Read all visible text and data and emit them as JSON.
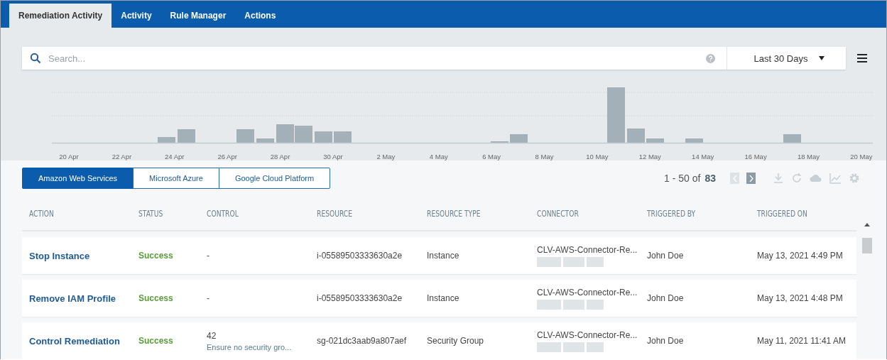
{
  "tabs": [
    {
      "label": "Remediation Activity",
      "selected": true
    },
    {
      "label": "Activity",
      "selected": false
    },
    {
      "label": "Rule Manager",
      "selected": false
    },
    {
      "label": "Actions",
      "selected": false
    }
  ],
  "search": {
    "placeholder": "Search...",
    "period": "Last 30 Days"
  },
  "chart": {
    "x_labels": [
      "20 Apr",
      "22 Apr",
      "24 Apr",
      "26 Apr",
      "28 Apr",
      "30 Apr",
      "2 May",
      "4 May",
      "6 May",
      "8 May",
      "10 May",
      "12 May",
      "14 May",
      "16 May",
      "18 May",
      "20 May"
    ]
  },
  "providers": [
    {
      "label": "Amazon Web Services",
      "selected": true
    },
    {
      "label": "Microsoft Azure",
      "selected": false
    },
    {
      "label": "Google Cloud Platform",
      "selected": false
    }
  ],
  "pagination": {
    "range": "1 - 50 of",
    "total": "83",
    "prev_disabled": true,
    "next_disabled": false
  },
  "table": {
    "columns": [
      "ACTION",
      "STATUS",
      "CONTROL",
      "RESOURCE",
      "RESOURCE TYPE",
      "CONNECTOR",
      "TRIGGERED BY",
      "TRIGGERED ON"
    ],
    "rows": [
      {
        "action": "Stop Instance",
        "status": "Success",
        "control": "-",
        "resource": "i-05589503333630a2e",
        "resource_type": "Instance",
        "connector": "CLV-AWS-Connector-Re...",
        "triggered_by": "John Doe",
        "triggered_on": "May 13, 2021 4:49 PM"
      },
      {
        "action": "Remove IAM Profile",
        "status": "Success",
        "control": "-",
        "resource": "i-05589503333630a2e",
        "resource_type": "Instance",
        "connector": "CLV-AWS-Connector-Re...",
        "triggered_by": "John Doe",
        "triggered_on": "May 13, 2021 4:48 PM"
      },
      {
        "action": "Control Remediation",
        "status": "Success",
        "control": "42",
        "control_detail": "Ensure no security gro...",
        "resource": "sg-021dc3aab9a807aef",
        "resource_type": "Security Group",
        "connector": "CLV-AWS-Connector-Re...",
        "triggered_by": "John Doe",
        "triggered_on": "May 11, 2021 11:41 AM"
      }
    ]
  }
}
